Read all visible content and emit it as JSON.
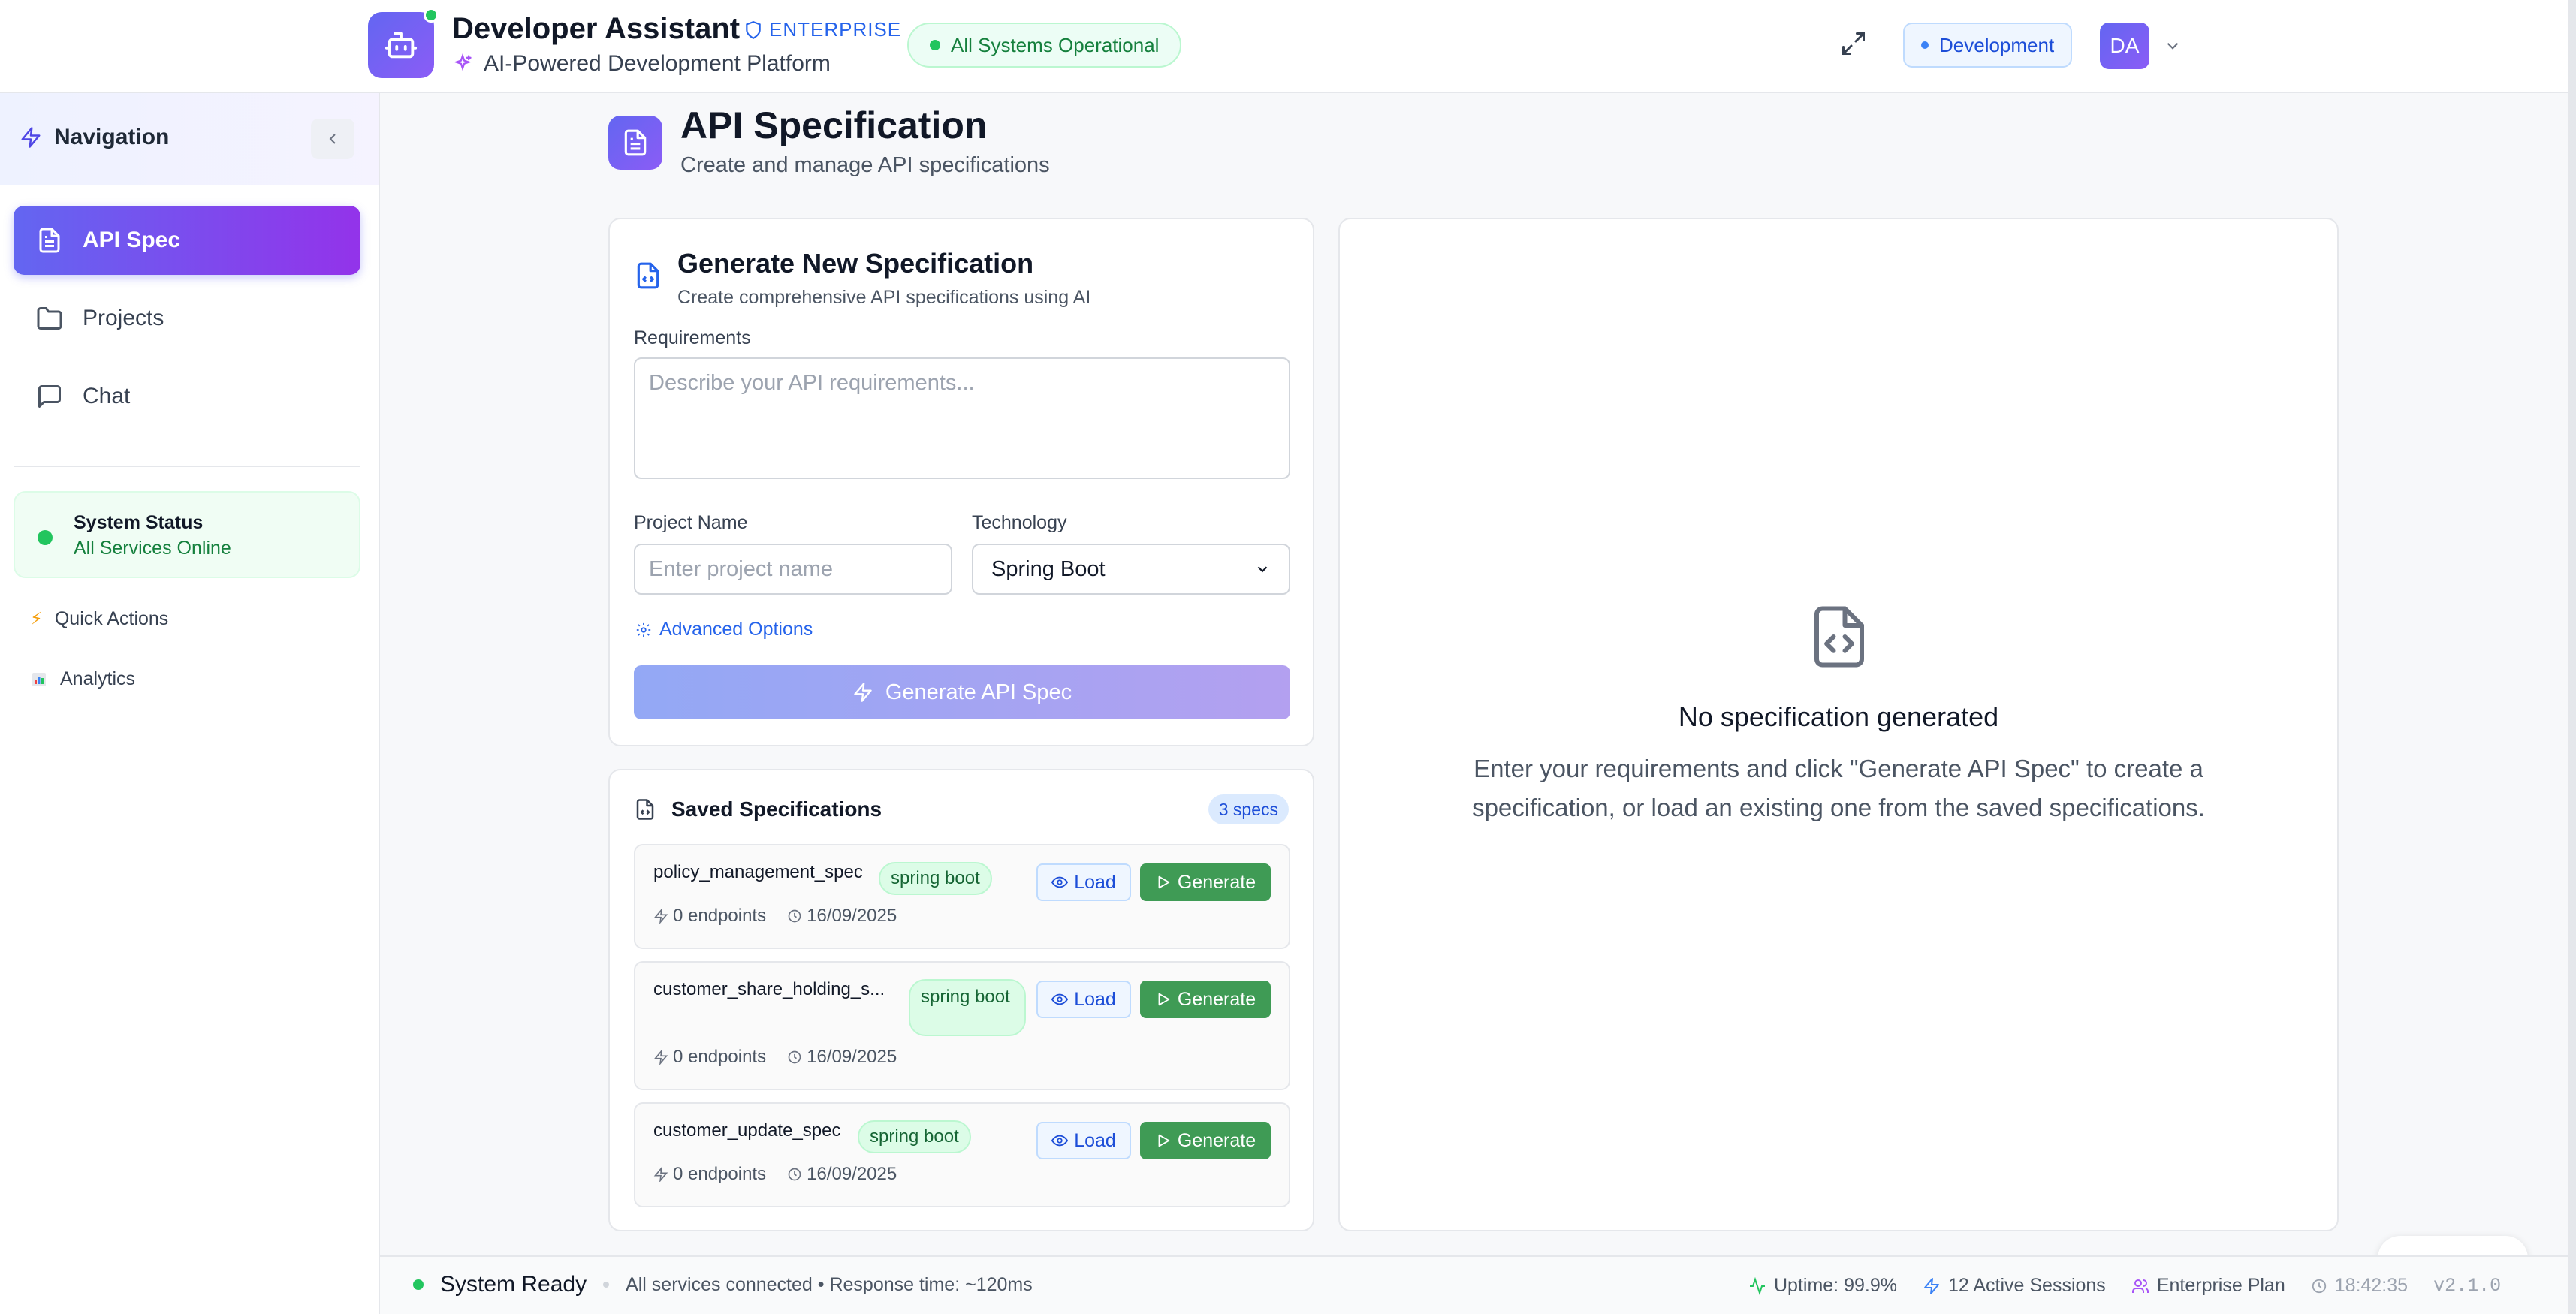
{
  "header": {
    "title": "Developer Assistant",
    "edition_badge": "ENTERPRISE",
    "subtitle": "AI-Powered Development Platform",
    "system_status": "All Systems Operational",
    "environment": "Development",
    "user_initials": "DA"
  },
  "sidebar": {
    "title": "Navigation",
    "items": [
      {
        "label": "API Spec",
        "icon": "file-text-icon",
        "active": true
      },
      {
        "label": "Projects",
        "icon": "folder-icon",
        "active": false
      },
      {
        "label": "Chat",
        "icon": "message-square-icon",
        "active": false
      }
    ],
    "status_card": {
      "title": "System Status",
      "subtitle": "All Services Online"
    },
    "links": [
      {
        "label": "Quick Actions",
        "icon": "lightning-emoji-icon"
      },
      {
        "label": "Analytics",
        "icon": "bar-chart-emoji-icon"
      }
    ]
  },
  "page": {
    "title": "API Specification",
    "subtitle": "Create and manage API specifications"
  },
  "generator": {
    "title": "Generate New Specification",
    "subtitle": "Create comprehensive API specifications using AI",
    "requirements_label": "Requirements",
    "requirements_placeholder": "Describe your API requirements...",
    "requirements_value": "",
    "project_label": "Project Name",
    "project_placeholder": "Enter project name",
    "project_value": "",
    "technology_label": "Technology",
    "technology_value": "Spring Boot",
    "advanced_label": "Advanced Options",
    "generate_label": "Generate API Spec"
  },
  "saved": {
    "title": "Saved Specifications",
    "count": "3 specs",
    "load_label": "Load",
    "generate_label": "Generate",
    "items": [
      {
        "name": "policy_management_spec",
        "tech": "spring boot",
        "endpoints": "0 endpoints",
        "date": "16/09/2025"
      },
      {
        "name": "customer_share_holding_s...",
        "tech": "spring boot",
        "endpoints": "0 endpoints",
        "date": "16/09/2025"
      },
      {
        "name": "customer_update_spec",
        "tech": "spring boot",
        "endpoints": "0 endpoints",
        "date": "16/09/2025"
      }
    ]
  },
  "preview": {
    "empty_title": "No specification generated",
    "empty_text": "Enter your requirements and click \"Generate API Spec\" to create a specification, or load an existing one from the saved specifications."
  },
  "footer": {
    "status": "System Ready",
    "details": "All services connected • Response time: ~120ms",
    "uptime": "Uptime: 99.9%",
    "sessions": "12 Active Sessions",
    "plan": "Enterprise Plan",
    "time": "18:42:35",
    "version": "v2.1.0"
  },
  "colors": {
    "accent": "#6366f1",
    "accent_secondary": "#9333ea",
    "success": "#22c55e",
    "generate_button": "#3f9b55",
    "link": "#2563eb"
  }
}
